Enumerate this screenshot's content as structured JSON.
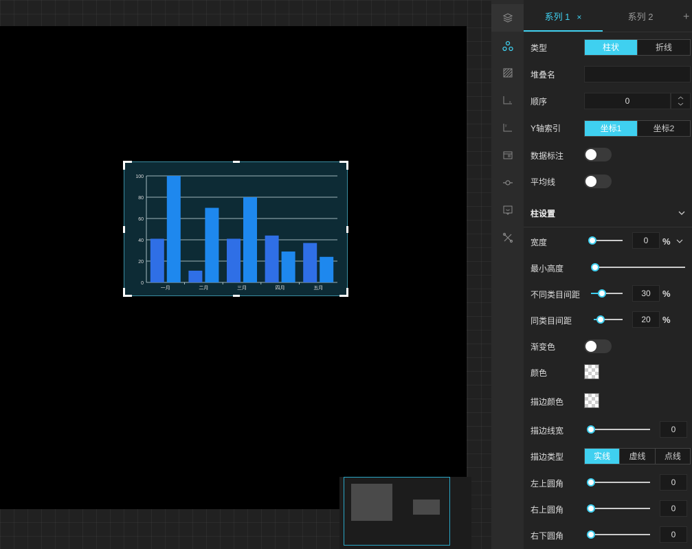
{
  "chart_data": {
    "type": "bar",
    "categories": [
      "一月",
      "二月",
      "三月",
      "四月",
      "五月"
    ],
    "series": [
      {
        "values": [
          41,
          11,
          41,
          44,
          37
        ],
        "color": "#2f6fe6"
      },
      {
        "values": [
          100,
          70,
          80,
          29,
          24
        ],
        "color": "#1e88ee"
      }
    ],
    "ylim": [
      0,
      100
    ],
    "yticks": [
      "0",
      "20",
      "40",
      "60",
      "80",
      "100"
    ],
    "grid": true
  },
  "panel": {
    "tabs": [
      {
        "label": "系列 1",
        "close": "×"
      },
      {
        "label": "系列 2"
      }
    ],
    "add": "+",
    "type": {
      "label": "类型",
      "options": [
        "柱状",
        "折线"
      ]
    },
    "stack": {
      "label": "堆叠名",
      "value": ""
    },
    "order": {
      "label": "顺序",
      "value": "0"
    },
    "yindex": {
      "label": "Y轴索引",
      "options": [
        "坐标1",
        "坐标2"
      ]
    },
    "data_label": {
      "label": "数据标注"
    },
    "avg_line": {
      "label": "平均线"
    },
    "bar_section": {
      "title": "柱设置"
    },
    "width": {
      "label": "宽度",
      "value": "0",
      "unit": "%",
      "level": 0
    },
    "min_height": {
      "label": "最小高度",
      "level": 0
    },
    "cat_gap": {
      "label": "不同类目间距",
      "value": "30",
      "unit": "%",
      "level": 0.3
    },
    "same_gap": {
      "label": "同类目间距",
      "value": "20",
      "unit": "%",
      "level": 0.2
    },
    "gradient": {
      "label": "渐变色"
    },
    "color": {
      "label": "颜色"
    },
    "border_color": {
      "label": "描边颜色"
    },
    "border_width": {
      "label": "描边线宽",
      "value": "0",
      "level": 0
    },
    "border_type": {
      "label": "描边类型",
      "options": [
        "实线",
        "虚线",
        "点线"
      ]
    },
    "radius_tl": {
      "label": "左上圆角",
      "value": "0",
      "level": 0
    },
    "radius_tr": {
      "label": "右上圆角",
      "value": "0",
      "level": 0
    },
    "radius_br": {
      "label": "右下圆角",
      "value": "0",
      "level": 0
    }
  },
  "icons": [
    "layers-icon",
    "series-icon",
    "grid-icon",
    "x-axis-icon",
    "y-axis-icon",
    "legend-icon",
    "marker-icon",
    "tooltip-icon",
    "tools-icon"
  ]
}
